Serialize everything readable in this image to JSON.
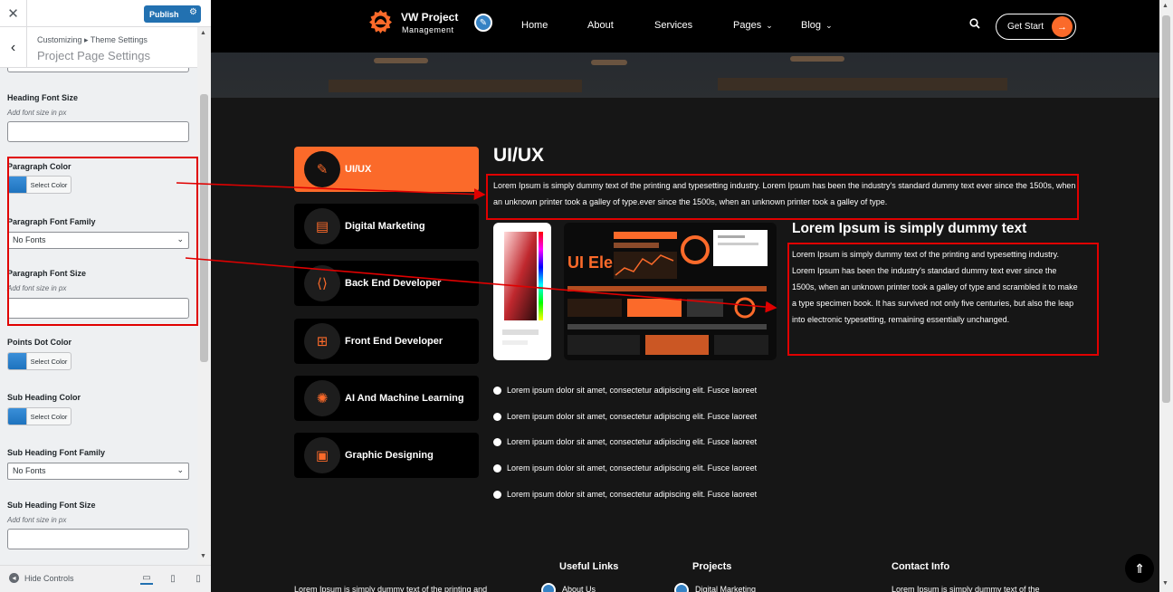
{
  "customizer": {
    "close_icon": "close-icon",
    "publish_label": "Publish",
    "breadcrumb": "Customizing ▸ Theme Settings",
    "section_title": "Project Page Settings",
    "fields": {
      "heading_font_size": {
        "label": "Heading Font Size",
        "hint": "Add font size in px",
        "value": ""
      },
      "paragraph_color": {
        "label": "Paragraph Color",
        "button": "Select Color",
        "swatch": "#1e73be"
      },
      "paragraph_font_family": {
        "label": "Paragraph Font Family",
        "value": "No Fonts"
      },
      "paragraph_font_size": {
        "label": "Paragraph Font Size",
        "hint": "Add font size in px",
        "value": ""
      },
      "points_dot_color": {
        "label": "Points Dot Color",
        "button": "Select Color",
        "swatch": "#1e73be"
      },
      "sub_heading_color": {
        "label": "Sub Heading Color",
        "button": "Select Color",
        "swatch": "#1e73be"
      },
      "sub_heading_font_family": {
        "label": "Sub Heading Font Family",
        "value": "No Fonts"
      },
      "sub_heading_font_size": {
        "label": "Sub Heading Font Size",
        "hint": "Add font size in px",
        "value": ""
      }
    },
    "footer": {
      "hide_controls": "Hide Controls"
    }
  },
  "site": {
    "logo": {
      "line1": "VW Project",
      "line2": "Management"
    },
    "nav": [
      "Home",
      "About",
      "Services",
      "Pages",
      "Blog"
    ],
    "cta": "Get Start",
    "accent": "#fb6a2a",
    "tabs": [
      {
        "label": "UI/UX",
        "icon": "design-icon",
        "active": true
      },
      {
        "label": "Digital Marketing",
        "icon": "marketing-icon",
        "active": false
      },
      {
        "label": "Back End Developer",
        "icon": "code-icon",
        "active": false
      },
      {
        "label": "Front End Developer",
        "icon": "flowchart-icon",
        "active": false
      },
      {
        "label": "AI And Machine Learning",
        "icon": "brain-icon",
        "active": false
      },
      {
        "label": "Graphic Designing",
        "icon": "monitor-design-icon",
        "active": false
      }
    ],
    "content": {
      "title": "UI/UX",
      "paragraph": "Lorem Ipsum is simply dummy text of the printing and typesetting industry. Lorem Ipsum has been the industry's standard dummy text ever since the 1500s, when an unknown printer took a galley of type.ever since the 1500s, when an unknown printer took a galley of type.",
      "image_text": "UI Elements",
      "sub_heading": "Lorem Ipsum is simply dummy text",
      "sub_paragraph": "Lorem Ipsum is simply dummy text of the printing and typesetting industry. Lorem Ipsum has been the industry's standard dummy text ever since the 1500s, when an unknown printer took a galley of type and scrambled it to make a type specimen book. It has survived not only five centuries, but also the leap into electronic typesetting, remaining essentially unchanged.",
      "points": [
        "Lorem ipsum dolor sit amet, consectetur adipiscing elit. Fusce laoreet",
        "Lorem ipsum dolor sit amet, consectetur adipiscing elit. Fusce laoreet",
        "Lorem ipsum dolor sit amet, consectetur adipiscing elit. Fusce laoreet",
        "Lorem ipsum dolor sit amet, consectetur adipiscing elit. Fusce laoreet",
        "Lorem ipsum dolor sit amet, consectetur adipiscing elit. Fusce laoreet"
      ]
    },
    "footer": {
      "about_text": "Lorem Ipsum is simply dummy text of the printing and",
      "useful_links": "Useful Links",
      "useful_first": "About Us",
      "projects": "Projects",
      "projects_first": "Digital Marketing",
      "contact": "Contact Info",
      "contact_text": "Lorem Ipsum is simply dummy text of the"
    }
  }
}
